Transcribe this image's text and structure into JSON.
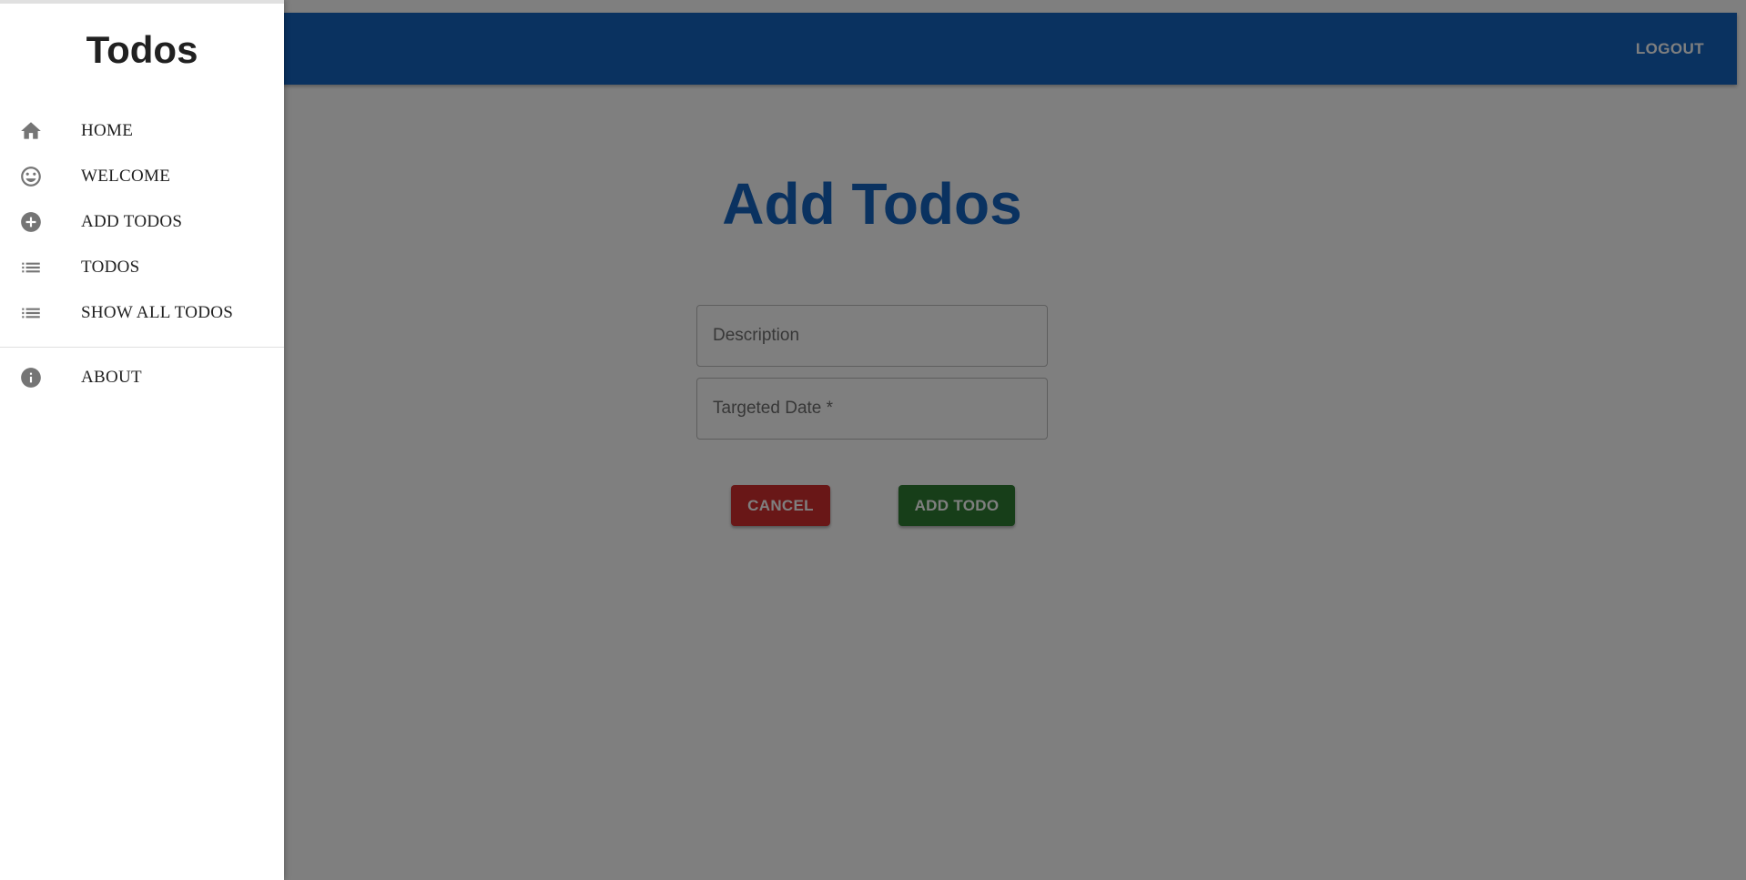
{
  "drawer": {
    "title": "Todos",
    "items": [
      {
        "label": "HOME",
        "icon": "home-icon"
      },
      {
        "label": "WELCOME",
        "icon": "smiley-face-icon"
      },
      {
        "label": "ADD TODOS",
        "icon": "add-circle-icon"
      },
      {
        "label": "TODOS",
        "icon": "list-icon"
      },
      {
        "label": "SHOW ALL TODOS",
        "icon": "list-icon"
      }
    ],
    "secondary_items": [
      {
        "label": "ABOUT",
        "icon": "info-icon"
      }
    ]
  },
  "appbar": {
    "logout_label": "LOGOUT"
  },
  "main": {
    "title": "Add Todos",
    "description_placeholder": "Description",
    "date_placeholder": "Targeted Date *",
    "cancel_label": "CANCEL",
    "add_label": "ADD TODO"
  },
  "colors": {
    "primary": "#1565c0",
    "cancel": "#d32f2f",
    "add": "#2e7d32",
    "backdrop": "rgba(0,0,0,0.5)"
  }
}
